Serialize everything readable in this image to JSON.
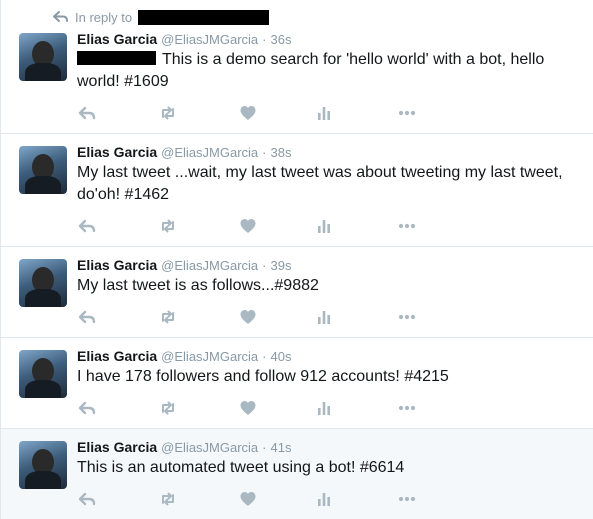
{
  "reply_context": {
    "label": "In reply to"
  },
  "colors": {
    "icon": "#aab8c2",
    "muted": "#8899a6",
    "text": "#14171a",
    "divider": "#e1e8ed",
    "highlight_bg": "#f5f8fa"
  },
  "icons": [
    "reply-icon",
    "retweet-icon",
    "like-icon",
    "analytics-icon",
    "more-icon"
  ],
  "tweets": [
    {
      "name": "Elias Garcia",
      "handle": "@EliasJMGarcia",
      "sep": "·",
      "time": "36s",
      "text": "This is a demo search for 'hello world' with a bot, hello world! #1609"
    },
    {
      "name": "Elias Garcia",
      "handle": "@EliasJMGarcia",
      "sep": "·",
      "time": "38s",
      "text": "My last tweet ...wait, my last tweet was about tweeting my last tweet, do'oh! #1462"
    },
    {
      "name": "Elias Garcia",
      "handle": "@EliasJMGarcia",
      "sep": "·",
      "time": "39s",
      "text": "My last tweet is as follows...#9882"
    },
    {
      "name": "Elias Garcia",
      "handle": "@EliasJMGarcia",
      "sep": "·",
      "time": "40s",
      "text": "I have 178 followers and follow 912 accounts! #4215"
    },
    {
      "name": "Elias Garcia",
      "handle": "@EliasJMGarcia",
      "sep": "·",
      "time": "41s",
      "text": "This is an automated tweet using a bot! #6614"
    }
  ]
}
